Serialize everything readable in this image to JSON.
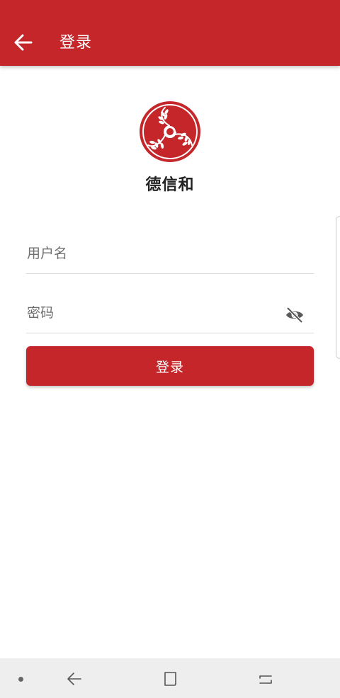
{
  "appbar": {
    "title": "登录",
    "back_icon": "arrow-left-icon",
    "color": "#c4262a"
  },
  "brand": {
    "name": "德信和",
    "logo_icon": "wheat-swirl-logo"
  },
  "form": {
    "username_placeholder": "用户名",
    "username_value": "",
    "password_placeholder": "密码",
    "password_value": "",
    "visibility_icon": "eye-off-icon",
    "submit_label": "登录"
  },
  "system_nav": {
    "icons": [
      "dot-icon",
      "back-icon",
      "recents-icon",
      "return-icon"
    ],
    "background": "#eeeeef"
  }
}
